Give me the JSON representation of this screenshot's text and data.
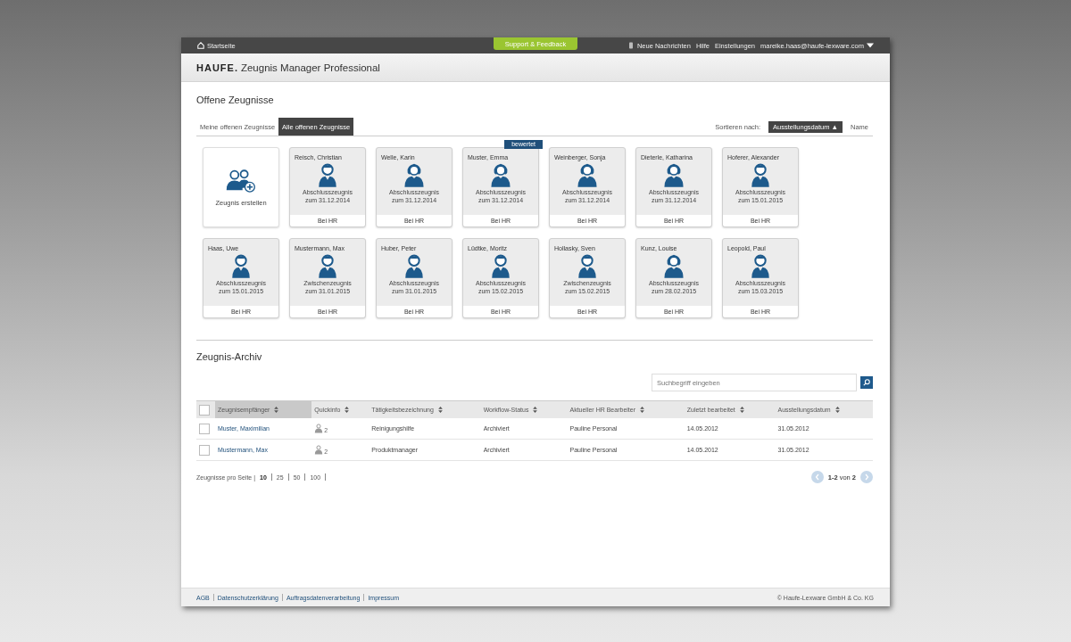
{
  "top_bar": {
    "home": "Startseite",
    "support": "Support & Feedback",
    "links": [
      {
        "kind": "messages",
        "label": "Neue Nachrichten"
      },
      {
        "kind": "plain",
        "label": "Hilfe"
      },
      {
        "kind": "plain",
        "label": "Einstellungen"
      },
      {
        "kind": "user",
        "label": "mareike.haas@haufe-lexware.com"
      }
    ]
  },
  "header": {
    "logo": "HAUFE.",
    "product": "Zeugnis Manager Professional"
  },
  "open_section": {
    "title": "Offene Zeugnisse",
    "tabs": [
      {
        "label": "Meine offenen Zeugnisse",
        "selected": false
      },
      {
        "label": "Alle offenen Zeugnisse",
        "selected": true
      }
    ],
    "sort_label": "Sortieren nach:",
    "sort_options": [
      {
        "label": "Ausstellungsdatum ▲",
        "selected": true
      },
      {
        "label": "Name",
        "selected": false
      }
    ],
    "create_tile": {
      "label": "Zeugnis erstellen"
    },
    "cards": [
      {
        "name": "Reisch, Christian",
        "kind": "male",
        "type": "Abschlusszeugnis",
        "date": "zum 31.12.2014",
        "status": "Bei HR"
      },
      {
        "name": "Welle, Karin",
        "kind": "female",
        "type": "Abschlusszeugnis",
        "date": "zum 31.12.2014",
        "status": "Bei HR"
      },
      {
        "name": "Muster, Emma",
        "kind": "female",
        "type": "Abschlusszeugnis",
        "date": "zum 31.12.2014",
        "status": "Bei HR",
        "badge": "bewertet"
      },
      {
        "name": "Weinberger, Sonja",
        "kind": "female",
        "type": "Abschlusszeugnis",
        "date": "zum 31.12.2014",
        "status": "Bei HR"
      },
      {
        "name": "Dieterle, Katharina",
        "kind": "female",
        "type": "Abschlusszeugnis",
        "date": "zum 31.12.2014",
        "status": "Bei HR"
      },
      {
        "name": "Hoferer, Alexander",
        "kind": "male",
        "type": "Abschlusszeugnis",
        "date": "zum 15.01.2015",
        "status": "Bei HR"
      },
      {
        "name": "Haas, Uwe",
        "kind": "male",
        "type": "Abschlusszeugnis",
        "date": "zum 15.01.2015",
        "status": "Bei HR"
      },
      {
        "name": "Mustermann, Max",
        "kind": "male",
        "type": "Zwischenzeugnis",
        "date": "zum 31.01.2015",
        "status": "Bei HR"
      },
      {
        "name": "Huber, Peter",
        "kind": "male",
        "type": "Abschlusszeugnis",
        "date": "zum 31.01.2015",
        "status": "Bei HR"
      },
      {
        "name": "Lüdtke, Moritz",
        "kind": "male",
        "type": "Abschlusszeugnis",
        "date": "zum 15.02.2015",
        "status": "Bei HR"
      },
      {
        "name": "Hollasky, Sven",
        "kind": "male",
        "type": "Zwischenzeugnis",
        "date": "zum 15.02.2015",
        "status": "Bei HR"
      },
      {
        "name": "Kunz, Louise",
        "kind": "female",
        "type": "Abschlusszeugnis",
        "date": "zum 28.02.2015",
        "status": "Bei HR"
      },
      {
        "name": "Leopold, Paul",
        "kind": "male",
        "type": "Abschlusszeugnis",
        "date": "zum 15.03.2015",
        "status": "Bei HR"
      }
    ]
  },
  "archive": {
    "title": "Zeugnis-Archiv",
    "search": {
      "placeholder": "Suchbegriff eingeben"
    },
    "table": {
      "select_all_checked": false,
      "columns": [
        {
          "label": "Zeugnisempfänger",
          "sorted": true
        },
        {
          "label": "Quickinfo",
          "sorted": false
        },
        {
          "label": "Tätigkeitsbezeichnung",
          "sorted": false
        },
        {
          "label": "Workflow-Status",
          "sorted": false
        },
        {
          "label": "Aktueller HR Bearbeiter",
          "sorted": false
        },
        {
          "label": "Zuletzt bearbeitet",
          "sorted": false
        },
        {
          "label": "Ausstellungsdatum",
          "sorted": false
        }
      ],
      "rows": [
        {
          "checked": false,
          "name": "Muster, Maximilian",
          "quickinfo": "2",
          "job": "Reinigungshilfe",
          "status": "Archiviert",
          "editor": "Pauline Personal",
          "edited": "14.05.2012",
          "issued": "31.05.2012"
        },
        {
          "checked": false,
          "name": "Mustermann, Max",
          "quickinfo": "2",
          "job": "Produktmanager",
          "status": "Archiviert",
          "editor": "Pauline Personal",
          "edited": "14.05.2012",
          "issued": "31.05.2012"
        }
      ]
    },
    "per_page": {
      "label": "Zeugnisse pro Seite |",
      "options": [
        {
          "label": "10",
          "selected": true
        },
        {
          "label": "25",
          "selected": false
        },
        {
          "label": "50",
          "selected": false
        },
        {
          "label": "100",
          "selected": false
        }
      ]
    },
    "pagination": "**1-2** von **2**"
  },
  "footer": {
    "links": [
      "AGB",
      "Datenschutzerklärung",
      "Auftragsdatenverarbeitung",
      "Impressum"
    ],
    "copyright": "© Haufe-Lexware GmbH & Co. KG"
  }
}
